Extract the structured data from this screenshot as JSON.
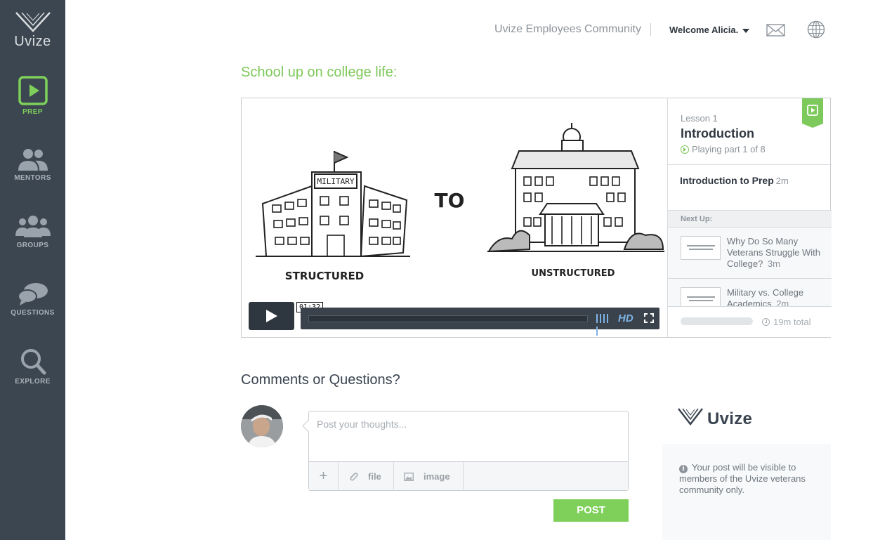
{
  "sidebar": {
    "logo_text": "Uvize",
    "items": [
      {
        "label": "PREP",
        "icon": "play-icon",
        "active": true
      },
      {
        "label": "MENTORS",
        "icon": "mentors-icon",
        "active": false
      },
      {
        "label": "GROUPS",
        "icon": "groups-icon",
        "active": false
      },
      {
        "label": "QUESTIONS",
        "icon": "speech-bubbles-icon",
        "active": false
      },
      {
        "label": "EXPLORE",
        "icon": "search-icon",
        "active": false
      }
    ]
  },
  "header": {
    "community": "Uvize Employees Community",
    "welcome": "Welcome Alicia.",
    "icons": [
      "mail-icon",
      "globe-icon"
    ]
  },
  "main": {
    "headline": "School up on college life:"
  },
  "player": {
    "slide": {
      "left_sign": "MILITARY",
      "left_caption": "STRUCTURED",
      "center_text": "TO",
      "right_caption": "UNSTRUCTURED"
    },
    "time_tooltip": "01:32",
    "hd_label": "HD",
    "progress": 0.0
  },
  "lesson": {
    "number": "Lesson 1",
    "title": "Introduction",
    "status": "Playing part 1 of 8",
    "current": {
      "title": "Introduction to Prep",
      "duration": "2m"
    },
    "next_up_label": "Next Up:",
    "next": [
      {
        "title": "Why Do So Many Veterans Struggle With College?",
        "duration": "3m"
      },
      {
        "title": "Military vs. College Academics",
        "duration": "2m"
      }
    ],
    "total": "19m total"
  },
  "comments": {
    "heading": "Comments or Questions?",
    "placeholder": "Post your thoughts...",
    "tools": {
      "plus": "+",
      "file": "file",
      "image": "image"
    },
    "post_label": "POST"
  },
  "info": {
    "brand": "Uvize",
    "notice": "Your post will be visible to members of the Uvize veterans community only."
  },
  "colors": {
    "sidebar_bg": "#3c4650",
    "accent_green": "#7ec95b",
    "hd_blue": "#7fb3e6"
  }
}
